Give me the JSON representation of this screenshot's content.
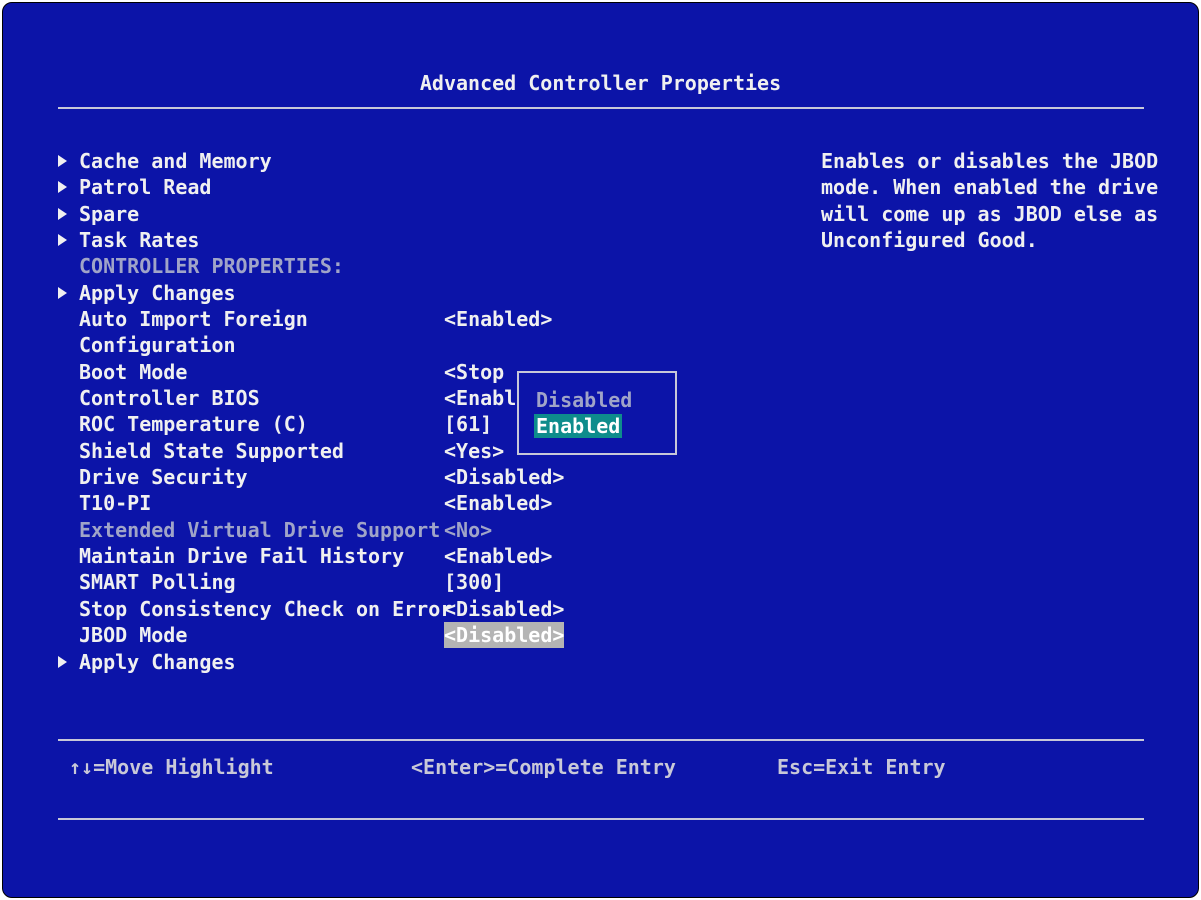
{
  "title": "Advanced Controller Properties",
  "menu_links": [
    {
      "label": "Cache and Memory"
    },
    {
      "label": "Patrol Read"
    },
    {
      "label": "Spare"
    },
    {
      "label": "Task Rates"
    }
  ],
  "section_header": "CONTROLLER PROPERTIES:",
  "apply_changes_top": "Apply Changes",
  "settings": [
    {
      "label": "Auto Import Foreign",
      "label2": "Configuration",
      "value": "<Enabled>"
    },
    {
      "label": "Boot Mode",
      "value": "<Stop"
    },
    {
      "label": "Controller BIOS",
      "value": "<Enabl"
    },
    {
      "label": "ROC Temperature (C)",
      "value": "[61]"
    },
    {
      "label": "Shield State Supported",
      "value": "<Yes>"
    },
    {
      "label": "Drive Security",
      "value": "<Disabled>"
    },
    {
      "label": "T10-PI",
      "value": "<Enabled>"
    },
    {
      "label": "Extended Virtual Drive Support",
      "value": "<No>",
      "disabled": true
    },
    {
      "label": "Maintain Drive Fail History",
      "value": "<Enabled>"
    },
    {
      "label": "SMART Polling",
      "value": "[300]"
    },
    {
      "label": "Stop Consistency Check on Error",
      "value": "<Disabled>"
    },
    {
      "label": "JBOD Mode",
      "value": "<Disabled>",
      "highlighted": true
    }
  ],
  "apply_changes_bottom": "Apply Changes",
  "popup": {
    "options": [
      "Disabled",
      "Enabled"
    ],
    "selected": "Enabled"
  },
  "help_text": [
    "Enables or disables the JBOD",
    "mode. When enabled the drive",
    "will come up as JBOD else as",
    "Unconfigured Good."
  ],
  "footer": {
    "move": "↑↓=Move Highlight",
    "enter": "<Enter>=Complete Entry",
    "esc": "Esc=Exit Entry"
  },
  "colors": {
    "background": "#0c14a8",
    "highlight": "#b4b4b4",
    "selected_option": "#0e8c8c"
  }
}
